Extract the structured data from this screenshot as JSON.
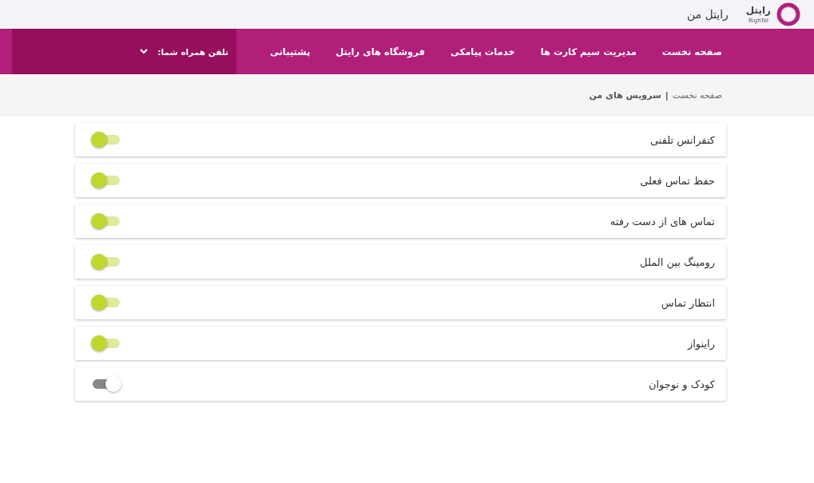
{
  "header": {
    "logo_text": "رایتل",
    "logo_subtext": "RighTel",
    "title": "رایتل من"
  },
  "nav": {
    "items": [
      "صفحه نخست",
      "مدیریت سیم کارت ها",
      "خدمات پیامکی",
      "فروشگاه های رایتل",
      "پشتیبانی"
    ],
    "phone_label": "تلفن همراه شما:"
  },
  "breadcrumb": [
    "صفحه نخست",
    "سرویس های من"
  ],
  "breadcrumb_separator": "|",
  "services": [
    {
      "label": "کنفرانس تلفنی",
      "on": true
    },
    {
      "label": "حفظ تماس فعلی",
      "on": true
    },
    {
      "label": "تماس های از دست رفته",
      "on": true
    },
    {
      "label": "رومینگ بین الملل",
      "on": true
    },
    {
      "label": "انتظار تماس",
      "on": true
    },
    {
      "label": "راینواز",
      "on": true
    },
    {
      "label": "کودک و نوجوان",
      "on": false
    }
  ]
}
